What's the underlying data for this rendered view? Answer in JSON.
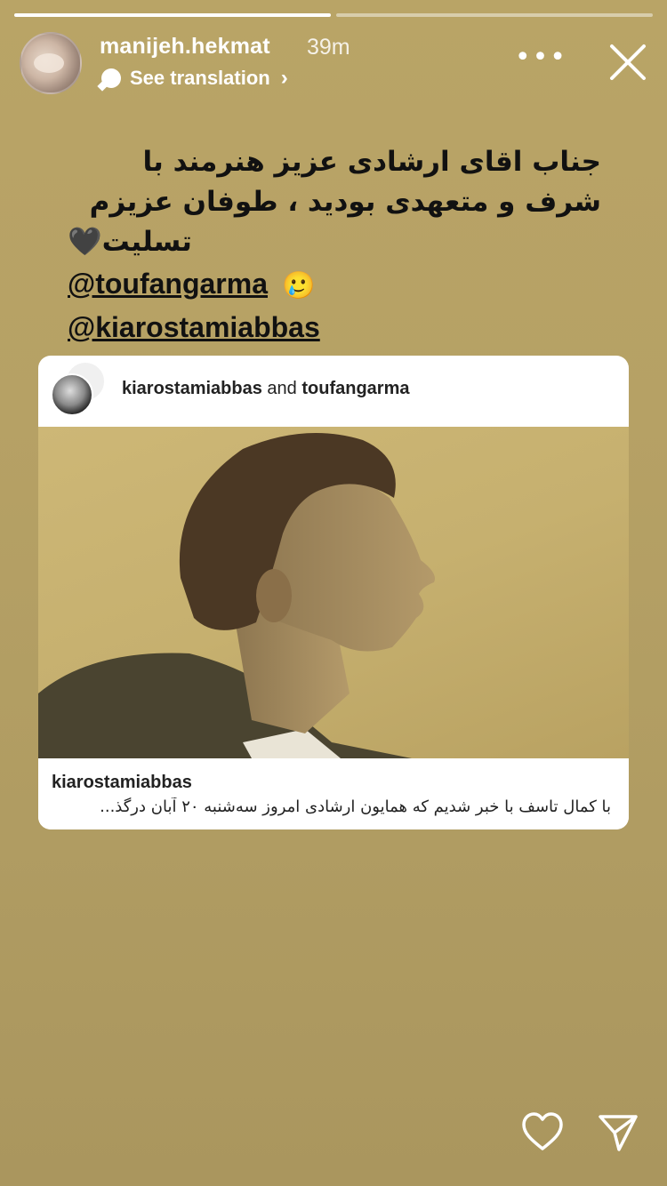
{
  "progress": [
    {
      "fill": 1.0
    },
    {
      "fill": 0.0
    }
  ],
  "header": {
    "username": "manijeh.hekmat",
    "time": "39m",
    "translation": "See translation",
    "more_icon": "more-dots-icon",
    "close_icon": "close-icon"
  },
  "story": {
    "text_lines": [
      "جناب اقای ارشادی عزیز  هنرمند با",
      "شرف و متعهدی بودید ، طوفان عزیزم",
      "تسلیت🖤"
    ],
    "mentions": [
      "@toufangarma",
      "@kiarostamiabbas"
    ],
    "emoji": "🥲"
  },
  "card": {
    "author_1": "kiarostamiabbas",
    "joiner": "and",
    "author_2": "toufangarma",
    "caption_user": "kiarostamiabbas",
    "caption": "با کمال تاسف با خبر شدیم که همایون ارشادی امروز سه‌شنبه ۲۰ آبان درگذ..."
  },
  "actions": {
    "like_icon": "heart-icon",
    "share_icon": "send-icon"
  },
  "colors": {
    "background": "#b19d63",
    "text_dark": "#111111",
    "card_bg": "#ffffff"
  }
}
